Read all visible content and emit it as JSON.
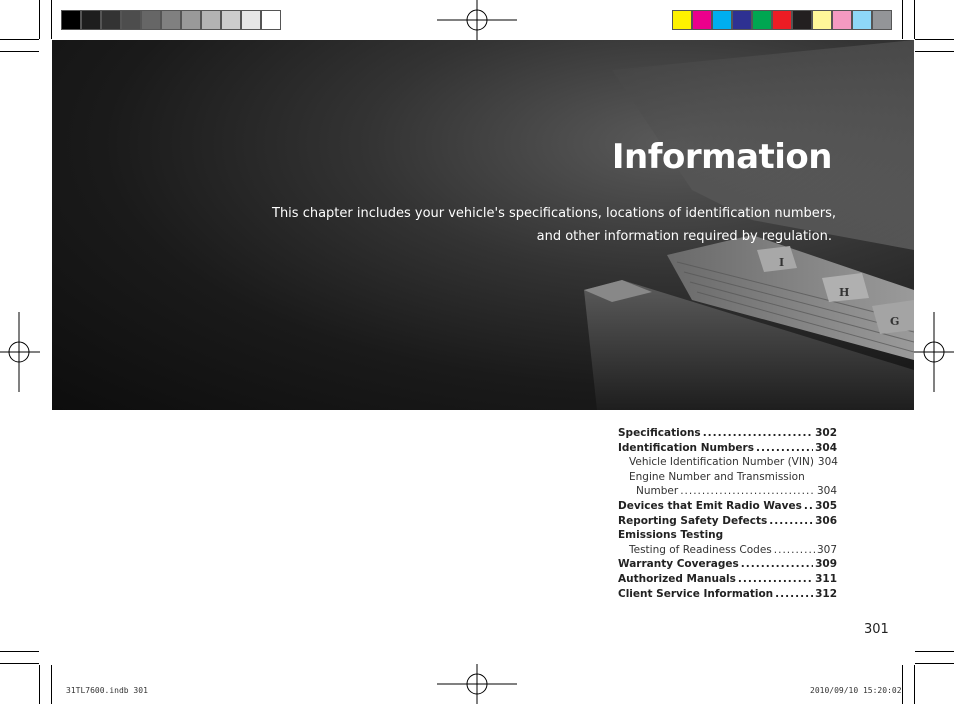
{
  "colors": {
    "gray_bar": [
      "#000000",
      "#1e1e1e",
      "#333333",
      "#4d4d4d",
      "#666666",
      "#808080",
      "#999999",
      "#b3b3b3",
      "#cccccc",
      "#e6e6e6",
      "#ffffff"
    ],
    "color_bar": [
      "#fff200",
      "#ec008c",
      "#00aeef",
      "#2e3192",
      "#00a651",
      "#ed1c24",
      "#231f20",
      "#fff799",
      "#f49ac1",
      "#8ed8f8",
      "#939598"
    ]
  },
  "chapter": {
    "title": "Information",
    "subtitle_line1": "This chapter includes your vehicle's specifications, locations of identification numbers,",
    "subtitle_line2": "and other information required by regulation."
  },
  "tab_letters": [
    "I",
    "H",
    "G"
  ],
  "toc": [
    {
      "label": "Specifications",
      "page": "302",
      "level": "main"
    },
    {
      "label": "Identification Numbers",
      "page": "304",
      "level": "main"
    },
    {
      "label": "Vehicle Identification Number (VIN)",
      "page": "304",
      "level": "sub"
    },
    {
      "label": "Engine Number and Transmission",
      "page": "",
      "level": "sub"
    },
    {
      "label": "Number",
      "page": "304",
      "level": "cont"
    },
    {
      "label": "Devices that Emit Radio Waves",
      "page": "305",
      "level": "main"
    },
    {
      "label": "Reporting Safety Defects",
      "page": "306",
      "level": "main"
    },
    {
      "label": "Emissions Testing",
      "page": "",
      "level": "main"
    },
    {
      "label": "Testing of Readiness Codes",
      "page": "307",
      "level": "sub"
    },
    {
      "label": "Warranty Coverages",
      "page": "309",
      "level": "main"
    },
    {
      "label": "Authorized Manuals",
      "page": "311",
      "level": "main"
    },
    {
      "label": "Client Service Information",
      "page": "312",
      "level": "main"
    }
  ],
  "page_number": "301",
  "slug_left": "31TL7600.indb   301",
  "slug_right": "2010/09/10   15:20:02"
}
